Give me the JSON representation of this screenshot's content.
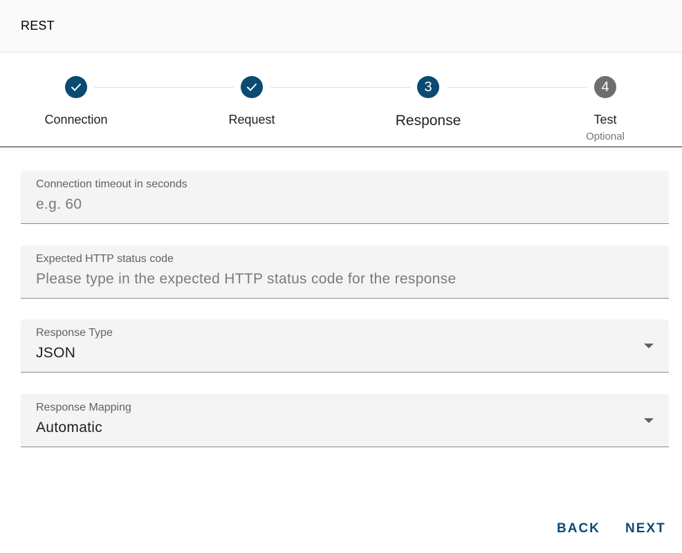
{
  "dialog": {
    "title": "REST"
  },
  "stepper": {
    "steps": [
      {
        "label": "Connection",
        "state": "completed",
        "icon": "check-icon"
      },
      {
        "label": "Request",
        "state": "completed",
        "icon": "check-icon"
      },
      {
        "label": "Response",
        "state": "active",
        "number": "3"
      },
      {
        "label": "Test",
        "state": "inactive",
        "number": "4",
        "sublabel": "Optional"
      }
    ]
  },
  "form": {
    "timeout": {
      "label": "Connection timeout in seconds",
      "value": "",
      "placeholder": "e.g. 60"
    },
    "status_code": {
      "label": "Expected HTTP status code",
      "value": "",
      "placeholder": "Please type in the expected HTTP status code for the response"
    },
    "response_type": {
      "label": "Response Type",
      "selected": "JSON"
    },
    "response_mapping": {
      "label": "Response Mapping",
      "selected": "Automatic"
    }
  },
  "actions": {
    "back_label": "BACK",
    "next_label": "NEXT"
  },
  "colors": {
    "accent": "#0b4a73",
    "inactive_step": "#6e6e6e",
    "field_background": "#f4f4f4"
  }
}
